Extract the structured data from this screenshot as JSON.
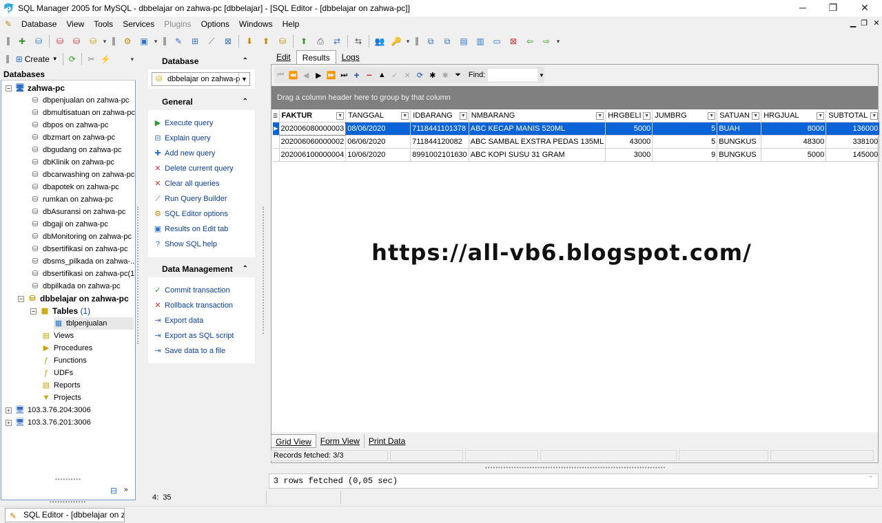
{
  "window": {
    "title": "SQL Manager 2005 for MySQL - dbbelajar on zahwa-pc [dbbelajar] - [SQL Editor - [dbbelajar on zahwa-pc]]",
    "minimize": "─",
    "restore": "❐",
    "close": "✕"
  },
  "menu": [
    "Database",
    "View",
    "Tools",
    "Services",
    "Plugins",
    "Options",
    "Windows",
    "Help"
  ],
  "toolbar2": {
    "create_label": "Create"
  },
  "databases": {
    "header": "Databases",
    "host": "zahwa-pc",
    "items": [
      "dbpenjualan on zahwa-pc",
      "dbmultisatuan on zahwa-pc",
      "dbpos on zahwa-pc",
      "dbzmart on zahwa-pc",
      "dbgudang on zahwa-pc",
      "dbKlinik on zahwa-pc",
      "dbcarwashing on zahwa-pc",
      "dbapotek on zahwa-pc",
      "rumkan on zahwa-pc",
      "dbAsuransi on zahwa-pc",
      "dbgaji on zahwa-pc",
      "dbMonitoring on zahwa-pc",
      "dbsertifikasi on zahwa-pc",
      "dbsms_pilkada on zahwa-...",
      "dbsertifikasi on zahwa-pc(1)",
      "dbpilkada on zahwa-pc"
    ],
    "active_db": "dbbelajar on zahwa-pc",
    "tables_label": "Tables",
    "tables_count": "(1)",
    "table_item": "tblpenjualan",
    "folders": [
      "Views",
      "Procedures",
      "Functions",
      "UDFs",
      "Reports",
      "Projects"
    ],
    "hosts": [
      "103.3.76.204:3006",
      "103.3.76.201:3006"
    ]
  },
  "side": {
    "database_header": "Database",
    "selected_db": "dbbelajar on zahwa-p",
    "general_header": "General",
    "general_actions": [
      "Execute query",
      "Explain query",
      "Add new query",
      "Delete current query",
      "Clear all queries",
      "Run Query Builder",
      "SQL Editor options",
      "Results on Edit tab",
      "Show SQL help"
    ],
    "data_header": "Data Management",
    "data_actions": [
      "Commit transaction",
      "Rollback transaction",
      "Export data",
      "Export as SQL script",
      "Save data to a file"
    ]
  },
  "editor": {
    "tabs": [
      "Edit",
      "Results",
      "Logs"
    ],
    "find_label": "Find:",
    "group_hint": "Drag a column header here to group by that column",
    "columns": [
      "FAKTUR",
      "TANGGAL",
      "IDBARANG",
      "NMBARANG",
      "HRGBELI",
      "JUMBRG",
      "SATUAN",
      "HRGJUAL",
      "SUBTOTAL"
    ],
    "rows": [
      [
        "202006080000003",
        "08/06/2020",
        "7118441101378",
        "ABC KECAP MANIS 520ML",
        "5000",
        "5",
        "BUAH",
        "8000",
        "136000"
      ],
      [
        "202006060000002",
        "06/06/2020",
        "711844120082",
        "ABC SAMBAL EXSTRA PEDAS 135ML",
        "43000",
        "5",
        "BUNGKUS",
        "48300",
        "338100"
      ],
      [
        "202006100000004",
        "10/06/2020",
        "8991002101630",
        "ABC KOPI SUSU 31 GRAM",
        "3000",
        "9",
        "BUNGKUS",
        "5000",
        "145000"
      ]
    ],
    "watermark": "https://all-vb6.blogspot.com/",
    "bottom_tabs": [
      "Grid View",
      "Form View",
      "Print Data"
    ],
    "records_fetched": "Records fetched: 3/3",
    "message": "3 rows fetched (0,05 sec)"
  },
  "status": {
    "line": "4:",
    "col": "35"
  },
  "taskbar": {
    "item": "SQL Editor - [dbbelajar on za..."
  },
  "colors": {
    "selection": "#0a64d8",
    "link": "#0a3f9c",
    "group_bar": "#808080"
  }
}
